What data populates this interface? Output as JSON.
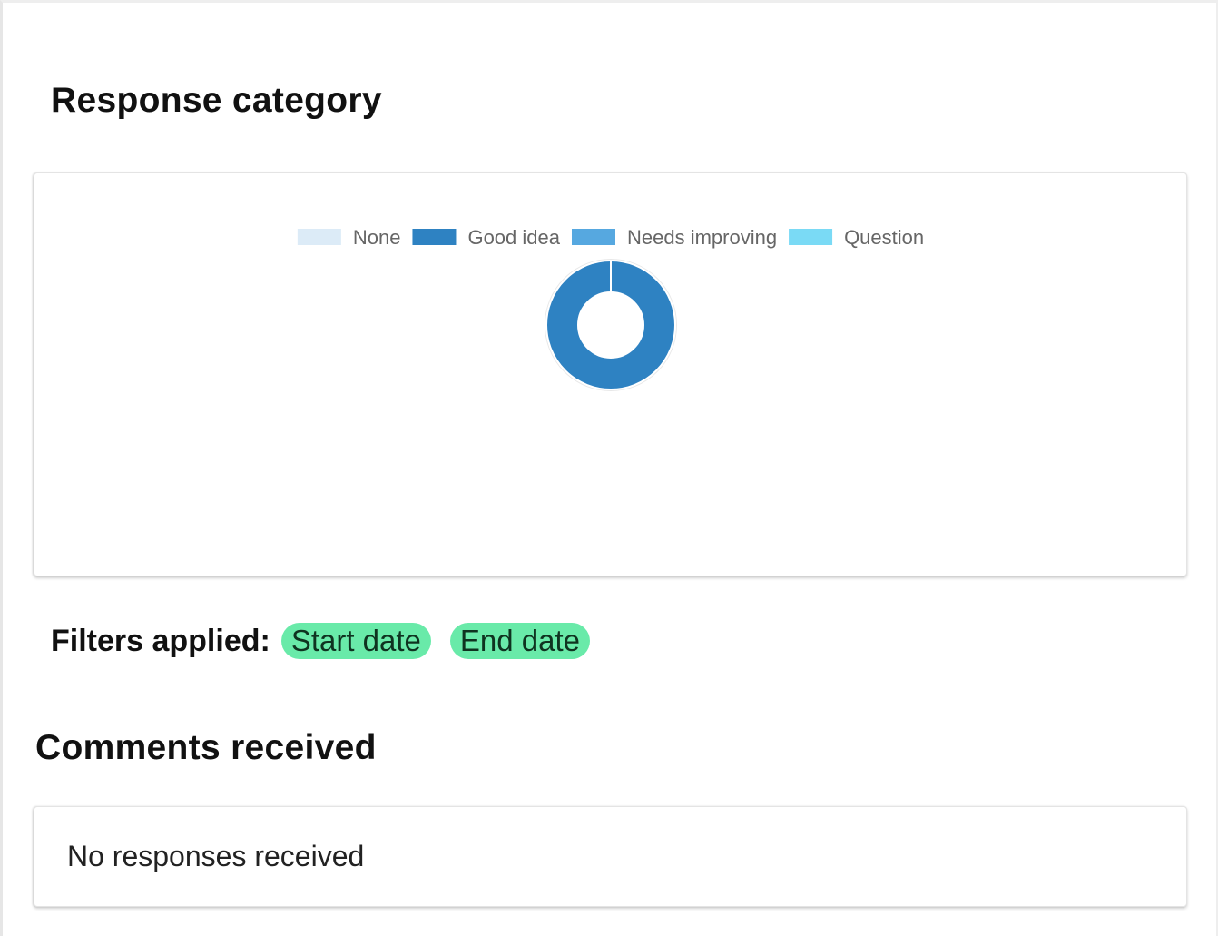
{
  "response_category": {
    "title": "Response category"
  },
  "chart_data": {
    "type": "pie",
    "variant": "doughnut",
    "categories": [
      "None",
      "Good idea",
      "Needs improving",
      "Question"
    ],
    "values": [
      0,
      1,
      0,
      0
    ],
    "colors": [
      "#dcebf7",
      "#2e82c2",
      "#56a8e0",
      "#7adaf5"
    ],
    "legend_position": "top"
  },
  "filters": {
    "label": "Filters applied:",
    "chips": [
      {
        "label": "Start date"
      },
      {
        "label": "End date"
      }
    ],
    "chip_color": "#69eaa9"
  },
  "comments": {
    "title": "Comments received",
    "empty_message": "No responses received"
  }
}
